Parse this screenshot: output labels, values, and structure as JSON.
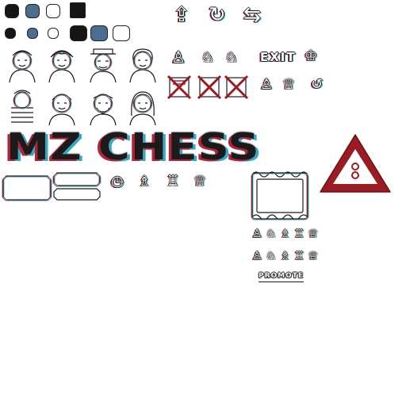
{
  "title": "MZ CHESS",
  "menu": {
    "exit_label": "EXIT"
  },
  "promotion": {
    "promote_label": "PROMOTE"
  },
  "colors": {
    "dark": "#151515",
    "blue": "#4a6e8e",
    "accent_red": "#b0253a",
    "accent_cyan": "#3aa8c0",
    "warning_red": "#9b1b22"
  },
  "icons": {
    "top_row": [
      "upload-icon",
      "refresh-icon",
      "swap-icon"
    ],
    "tool_row": [
      "pawn-icon",
      "knight-icon",
      "knight-icon",
      "crown-icon"
    ],
    "crossed_row": [
      "crossed-pawn-icon",
      "crossed-square-icon",
      "crossed-square-icon"
    ],
    "misc_row": [
      "pawn-icon",
      "crown-icon",
      "undo-icon"
    ],
    "button_pieces": [
      "clock-icon",
      "bishop-icon",
      "rook-icon",
      "queen-icon"
    ],
    "promo_pieces": [
      "pawn-icon",
      "knight-icon",
      "bishop-icon",
      "rook-icon",
      "queen-icon"
    ]
  }
}
